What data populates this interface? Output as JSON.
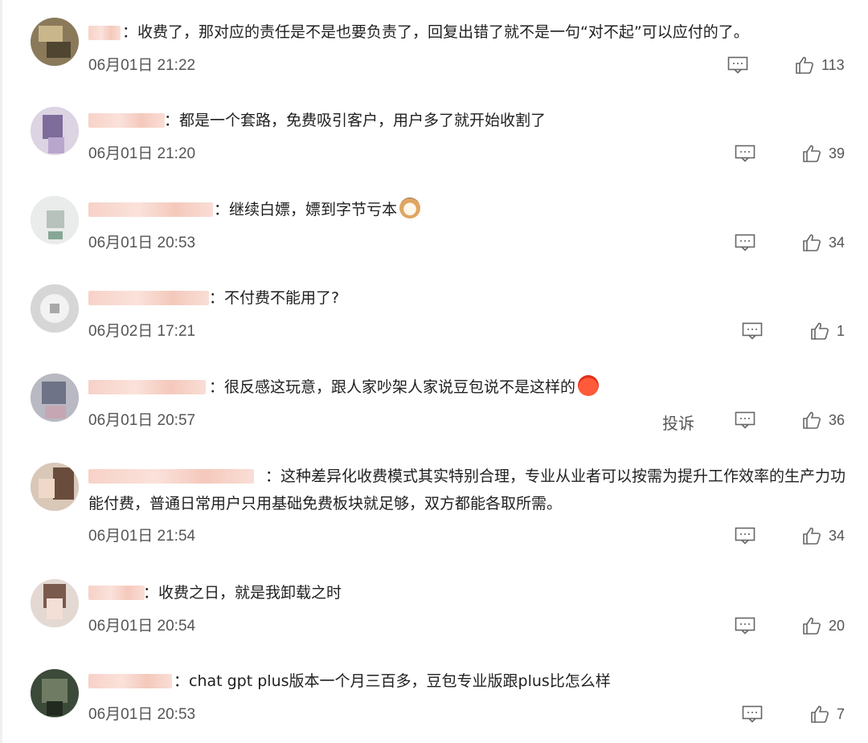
{
  "comments": [
    {
      "text": "：收费了，那对应的责任是不是也要负责了，回复出错了就不是一句“对不起”可以应付的了。",
      "time": "06月01日 21:22",
      "likes": "113",
      "reply_icon": "comment-icon",
      "like_icon": "thumbs-up-icon"
    },
    {
      "text": "：都是一个套路，免费吸引客户，用户多了就开始收割了",
      "time": "06月01日 21:20",
      "likes": "39"
    },
    {
      "text": "：继续白嫖，嫖到字节亏本",
      "emoji": "cat-emoji",
      "time": "06月01日 20:53",
      "likes": "34"
    },
    {
      "text": "：不付费不能用了?",
      "time": "06月02日 17:21",
      "likes": "1"
    },
    {
      "text": "：很反感这玩意，跟人家吵架人家说豆包说不是这样的",
      "emoji": "angry-emoji",
      "time": "06月01日 20:57",
      "report": "投诉",
      "likes": "36"
    },
    {
      "text": "：这种差异化收费模式其实特别合理，专业从业者可以按需为提升工作效率的生产力功能付费，普通日常用户只用基础免费板块就足够，双方都能各取所需。",
      "time": "06月01日 21:54",
      "likes": "34"
    },
    {
      "text": "：收费之日，就是我卸载之时",
      "time": "06月01日 20:54",
      "likes": "20"
    },
    {
      "text": "：chat gpt plus版本一个月三百多，豆包专业版跟plus比怎么样",
      "time": "06月01日 20:53",
      "likes": "7"
    }
  ]
}
